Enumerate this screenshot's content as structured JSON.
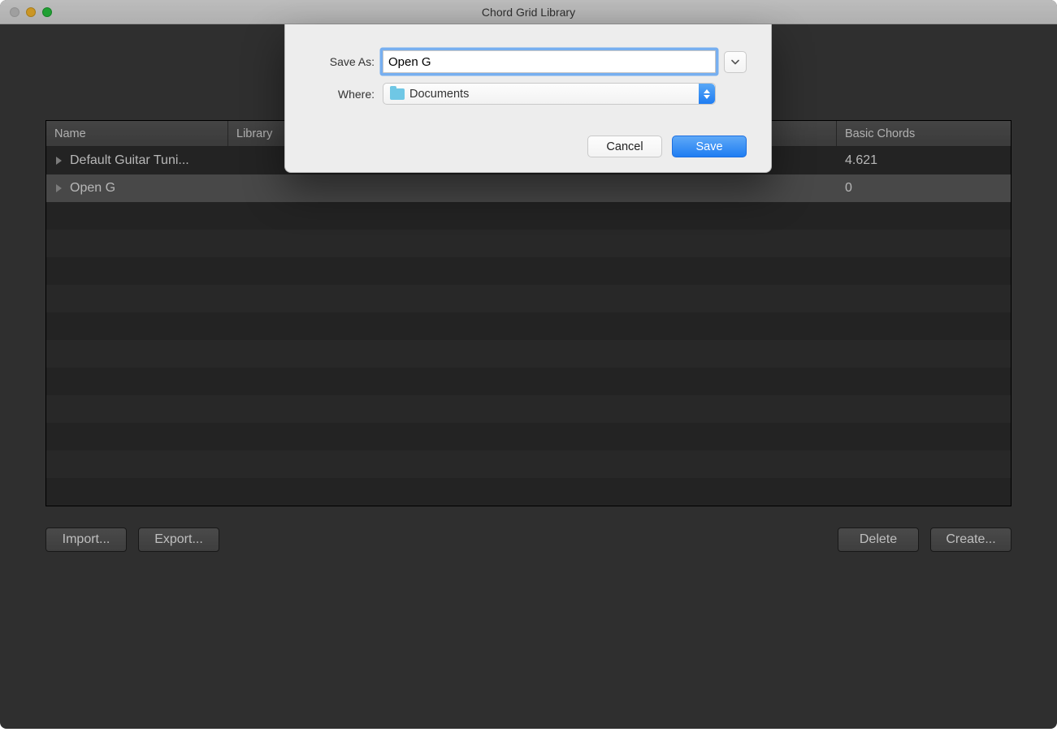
{
  "window": {
    "title": "Chord Grid Library"
  },
  "table": {
    "headers": {
      "name": "Name",
      "library": "Library",
      "basic": "Basic Chords"
    },
    "rows": [
      {
        "name": "Default Guitar Tuni...",
        "basic": "4.621"
      },
      {
        "name": "Open G",
        "basic": "0"
      }
    ]
  },
  "footer": {
    "import": "Import...",
    "export": "Export...",
    "delete": "Delete",
    "create": "Create..."
  },
  "sheet": {
    "save_as_label": "Save As:",
    "save_as_value": "Open G",
    "where_label": "Where:",
    "where_value": "Documents",
    "cancel": "Cancel",
    "save": "Save"
  }
}
